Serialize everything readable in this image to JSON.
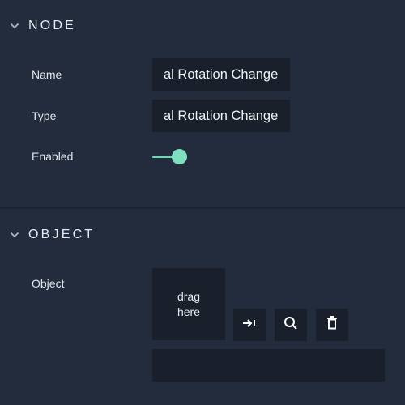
{
  "node_section": {
    "title": "NODE",
    "icon": "chevron-down-icon",
    "fields": {
      "name_label": "Name",
      "name_value": "al Rotation Change",
      "type_label": "Type",
      "type_value": "al Rotation Change",
      "enabled_label": "Enabled",
      "enabled_state": true
    }
  },
  "object_section": {
    "title": "OBJECT",
    "icon": "chevron-down-icon",
    "object_label": "Object",
    "dropzone_line1": "drag",
    "dropzone_line2": "here",
    "buttons": [
      {
        "icon": "arrow-right-to-bar-icon"
      },
      {
        "icon": "search-icon"
      },
      {
        "icon": "trash-icon"
      }
    ],
    "object_value": ""
  },
  "colors": {
    "background": "#222c3d",
    "field_background": "#1a202b",
    "accent": "#7fe0bf"
  }
}
